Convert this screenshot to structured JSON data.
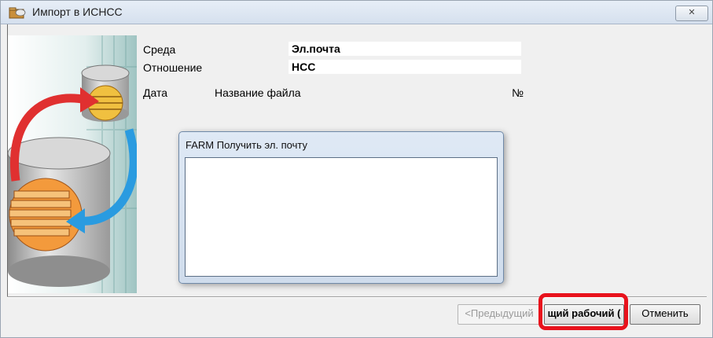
{
  "window": {
    "title": "Импорт в ИСНСС",
    "close_glyph": "✕"
  },
  "form": {
    "environment_label": "Среда",
    "environment_value": "Эл.почта",
    "relation_label": "Отношение",
    "relation_value": "НСС",
    "date_header": "Дата",
    "filename_header": "Название файла",
    "number_header": "№"
  },
  "dialog": {
    "title": "FARM Получить эл. почту"
  },
  "buttons": {
    "previous": "<Предыдущий",
    "next": "щий рабочий (",
    "cancel": "Отменить"
  },
  "colors": {
    "highlight": "#e8121c",
    "arrow_red": "#e03030",
    "arrow_blue": "#2a9be0",
    "disk_orange": "#f39a3c"
  },
  "icons": {
    "title": "folder-icon",
    "close": "close-icon",
    "illustration": "database-transfer-illustration"
  }
}
